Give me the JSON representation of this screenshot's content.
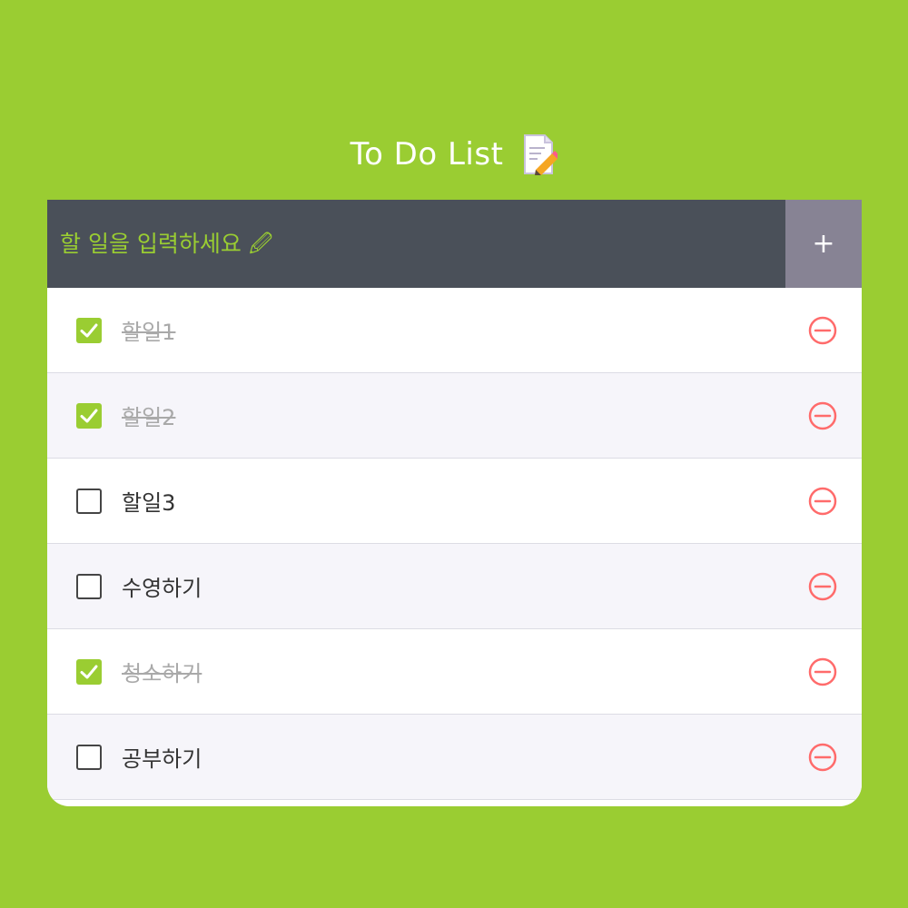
{
  "header": {
    "title": "To Do List",
    "title_icon": "memo-icon"
  },
  "input": {
    "placeholder": "할 일을 입력하세요 🖉",
    "value": ""
  },
  "add_button": {
    "label": "+"
  },
  "tasks": [
    {
      "text": "할일1",
      "done": true
    },
    {
      "text": "할일2",
      "done": true
    },
    {
      "text": "할일3",
      "done": false
    },
    {
      "text": "수영하기",
      "done": false
    },
    {
      "text": "청소하기",
      "done": true
    },
    {
      "text": "공부하기",
      "done": false
    }
  ],
  "icons": {
    "checkbox_checked": "check-icon",
    "delete": "minus-circle-icon"
  },
  "colors": {
    "background": "#9acd32",
    "accent": "#9acd32",
    "input_background": "#4a5059",
    "add_button_background": "#878394",
    "delete": "#ff6b6b",
    "done_text": "#a9a9a9"
  }
}
